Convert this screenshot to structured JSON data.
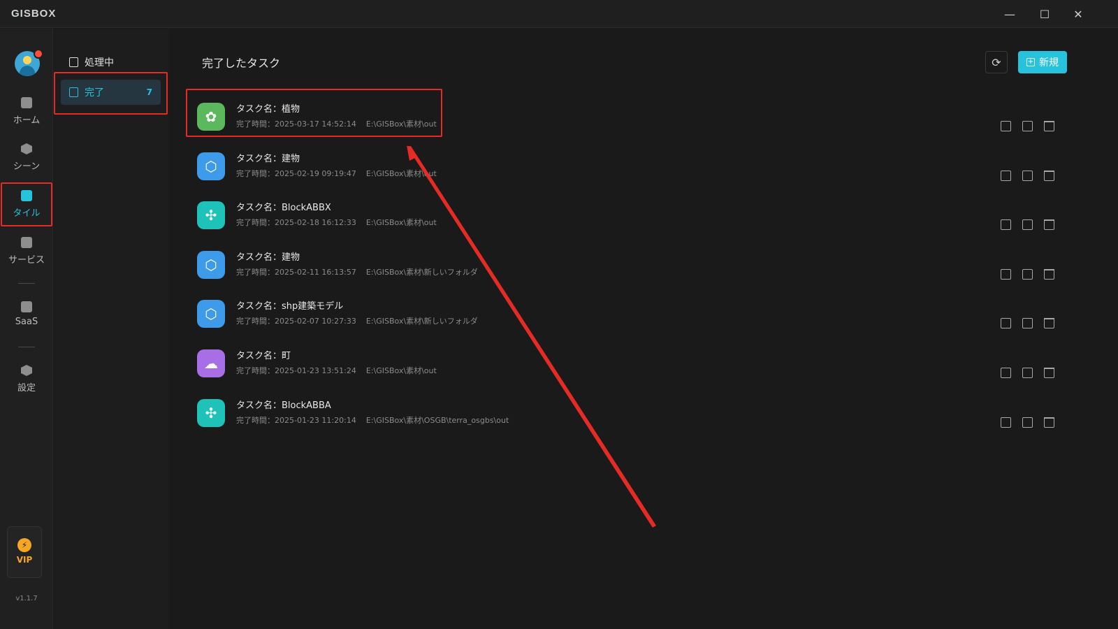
{
  "app": {
    "logo": "GISBOX"
  },
  "window": {
    "minimize": "—",
    "maximize": "☐",
    "close": "✕"
  },
  "rail": {
    "items": [
      {
        "label": "ホーム",
        "icon": "home-icon"
      },
      {
        "label": "シーン",
        "icon": "scene-icon"
      },
      {
        "label": "タイル",
        "icon": "tile-icon",
        "active": true
      },
      {
        "label": "サービス",
        "icon": "service-icon"
      },
      {
        "label": "SaaS",
        "icon": "saas-icon"
      },
      {
        "label": "設定",
        "icon": "settings-icon"
      }
    ],
    "vip_label": "VIP",
    "version": "v1.1.7"
  },
  "subnav": {
    "processing_label": "処理中",
    "done_label": "完了",
    "done_count": "7"
  },
  "main": {
    "title": "完了したタスク",
    "new_label": "新規",
    "tasks": [
      {
        "name": "タスク名：植物",
        "time": "完了時間：2025-03-17 14:52:14",
        "path": "E:\\GISBox\\素材\\out",
        "icon": "plant-icon",
        "color": "#5cb85c"
      },
      {
        "name": "タスク名：建物",
        "time": "完了時間：2025-02-19 09:19:47",
        "path": "E:\\GISBox\\素材\\out",
        "icon": "cube-icon",
        "color": "#3d9be9"
      },
      {
        "name": "タスク名：BlockABBX",
        "time": "完了時間：2025-02-18 16:12:33",
        "path": "E:\\GISBox\\素材\\out",
        "icon": "drone-icon",
        "color": "#1fc2b8"
      },
      {
        "name": "タスク名：建物",
        "time": "完了時間：2025-02-11 16:13:57",
        "path": "E:\\GISBox\\素材\\新しいフォルダ",
        "icon": "cube-icon",
        "color": "#3d9be9"
      },
      {
        "name": "タスク名：shp建築モデル",
        "time": "完了時間：2025-02-07 10:27:33",
        "path": "E:\\GISBox\\素材\\新しいフォルダ",
        "icon": "cube-icon",
        "color": "#3d9be9"
      },
      {
        "name": "タスク名：町",
        "time": "完了時間：2025-01-23 13:51:24",
        "path": "E:\\GISBox\\素材\\out",
        "icon": "cloud-icon",
        "color": "#a86ee6"
      },
      {
        "name": "タスク名：BlockABBA",
        "time": "完了時間：2025-01-23 11:20:14",
        "path": "E:\\GISBox\\素材\\OSGB\\terra_osgbs\\out",
        "icon": "drone-icon",
        "color": "#1fc2b8"
      }
    ]
  },
  "colors": {
    "accent": "#27c3dd",
    "highlight": "#e42b25",
    "vip": "#f5a623"
  }
}
